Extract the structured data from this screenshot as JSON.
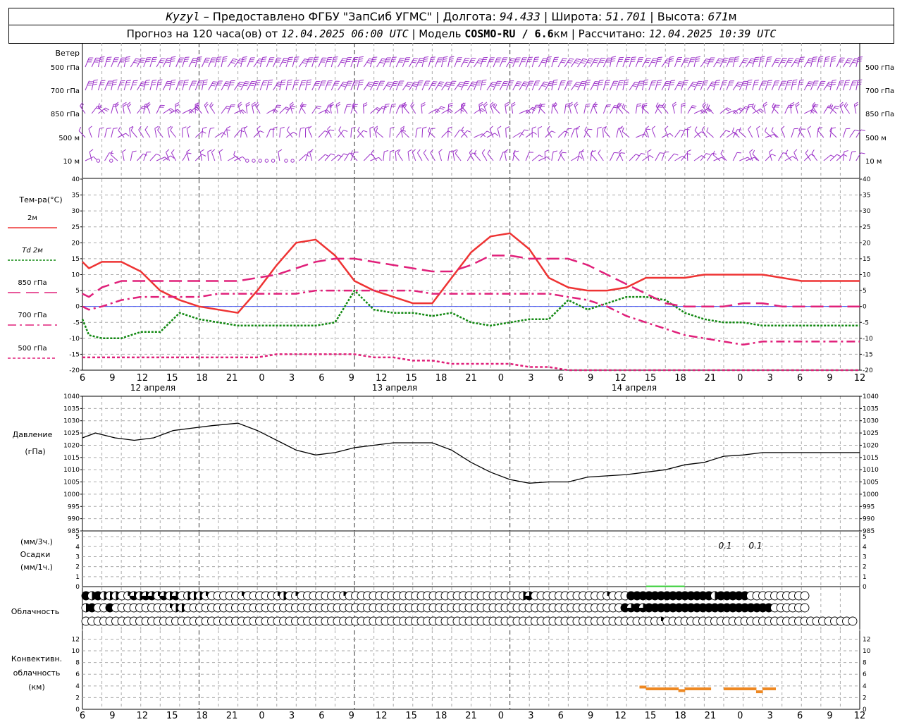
{
  "header": {
    "station": "Kyzyl",
    "provided": "Предоставлено ФГБУ \"ЗапСиб УГМС\"",
    "lon_label": "Долгота:",
    "lon": "94.433",
    "lat_label": "Широта:",
    "lat": "51.701",
    "alt_label": "Высота:",
    "alt": "671",
    "alt_unit": "м",
    "fc_label": "Прогноз на 120 часа(ов) от",
    "fc_time": "12.04.2025 06:00 UTC",
    "model_label": "Модель",
    "model": "COSMO-RU / 6.6",
    "model_unit": "км",
    "calc_label": "Рассчитано:",
    "calc_time": "12.04.2025 10:39 UTC"
  },
  "time_axis": {
    "ticks": [
      "6",
      "9",
      "12",
      "15",
      "18",
      "21",
      "0",
      "3",
      "6",
      "9",
      "12",
      "15",
      "18",
      "21",
      "0",
      "3",
      "6",
      "9",
      "12",
      "15",
      "18",
      "21",
      "0",
      "3",
      "6",
      "9",
      "12"
    ],
    "days": [
      "12 апреля",
      "13 апреля",
      "14 апреля"
    ]
  },
  "wind": {
    "title": "Ветер",
    "levels": [
      "500 гПа",
      "700 гПа",
      "850 гПа",
      "500 м",
      "10 м"
    ],
    "color": "#9b30c8"
  },
  "temperature": {
    "title": "Тем-ра(°C)",
    "legend": [
      {
        "label": "2м",
        "color": "#ee3333"
      },
      {
        "label": "Td  2м",
        "color": "#118811"
      },
      {
        "label": "850 гПа",
        "color": "#e0207a"
      },
      {
        "label": "700 гПа",
        "color": "#e0207a"
      },
      {
        "label": "500 гПа",
        "color": "#e0207a"
      }
    ],
    "ticks": [
      "40",
      "35",
      "30",
      "25",
      "20",
      "15",
      "10",
      "5",
      "0",
      "-5",
      "-10",
      "-15",
      "-20"
    ]
  },
  "pressure": {
    "title1": "Давление",
    "title2": "(гПа)",
    "ticks": [
      "1040",
      "1035",
      "1030",
      "1025",
      "1020",
      "1015",
      "1010",
      "1005",
      "1000",
      "995",
      "990",
      "985"
    ]
  },
  "precip": {
    "title1": "(мм/3ч.)",
    "title2": "Осадки",
    "title3": "(мм/1ч.)",
    "ticks": [
      "5",
      "4",
      "3",
      "2",
      "1",
      "0"
    ],
    "labels": [
      "0.1",
      "0.1"
    ]
  },
  "cloud": {
    "title": "Облачность"
  },
  "conv": {
    "title1": "Конвективн.",
    "title2": "облачность",
    "title3": "(км)",
    "ticks": [
      "12",
      "10",
      "8",
      "6",
      "4",
      "2",
      "0"
    ]
  },
  "chart_data": [
    {
      "type": "line",
      "title": "Тем-ра(°C)",
      "x_hours": [
        0,
        1,
        3,
        6,
        9,
        12,
        15,
        18,
        21,
        24,
        27,
        30,
        33,
        36,
        39,
        42,
        45,
        48,
        51,
        54,
        57,
        60,
        63,
        66,
        69,
        72,
        75,
        78,
        81,
        84,
        87,
        90,
        93,
        96,
        99,
        102,
        105,
        108,
        111,
        114,
        117,
        120
      ],
      "ylim": [
        -20,
        40
      ],
      "series": [
        {
          "name": "2м",
          "values": [
            14,
            12,
            14,
            14,
            11,
            5,
            2,
            0,
            -1,
            -2,
            5,
            13,
            20,
            21,
            16,
            8,
            5,
            3,
            1,
            1,
            9,
            17,
            22,
            23,
            18,
            9,
            6,
            5,
            5,
            6,
            9,
            9,
            9,
            10,
            10,
            10,
            10,
            9,
            8,
            8,
            8,
            8
          ]
        },
        {
          "name": "Td  2м",
          "values": [
            -4,
            -9,
            -10,
            -10,
            -8,
            -8,
            -2,
            -4,
            -5,
            -6,
            -6,
            -6,
            -6,
            -6,
            -5,
            5,
            -1,
            -2,
            -2,
            -3,
            -2,
            -5,
            -6,
            -5,
            -4,
            -4,
            2,
            -1,
            1,
            3,
            3,
            2,
            -2,
            -4,
            -5,
            -5,
            -6,
            -6,
            -6,
            -6,
            -6,
            -6
          ]
        },
        {
          "name": "850 гПа",
          "values": [
            4,
            3,
            6,
            8,
            8,
            8,
            8,
            8,
            8,
            8,
            9,
            10,
            12,
            14,
            15,
            15,
            14,
            13,
            12,
            11,
            11,
            13,
            16,
            16,
            15,
            15,
            15,
            13,
            10,
            7,
            4,
            1,
            0,
            0,
            0,
            1,
            1,
            0,
            0,
            0,
            0,
            0
          ]
        },
        {
          "name": "700 гПа",
          "values": [
            0,
            -1,
            0,
            2,
            3,
            3,
            3,
            3,
            4,
            4,
            4,
            4,
            4,
            5,
            5,
            5,
            5,
            5,
            5,
            4,
            4,
            4,
            4,
            4,
            4,
            4,
            3,
            2,
            0,
            -3,
            -5,
            -7,
            -9,
            -10,
            -11,
            -12,
            -11,
            -11,
            -11,
            -11,
            -11,
            -11
          ]
        },
        {
          "name": "500 гПа",
          "values": [
            -16,
            -16,
            -16,
            -16,
            -16,
            -16,
            -16,
            -16,
            -16,
            -16,
            -16,
            -15,
            -15,
            -15,
            -15,
            -15,
            -16,
            -16,
            -17,
            -17,
            -18,
            -18,
            -18,
            -18,
            -19,
            -19,
            -20,
            -20,
            -20,
            -20,
            -20,
            -20,
            -20,
            -20,
            -20,
            -20,
            -20,
            -20,
            -20,
            -20,
            -20,
            -20
          ]
        }
      ]
    },
    {
      "type": "line",
      "title": "Давление",
      "x_hours": [
        0,
        2,
        5,
        8,
        11,
        14,
        17,
        20,
        24,
        27,
        30,
        33,
        36,
        39,
        42,
        45,
        48,
        51,
        54,
        57,
        60,
        63,
        66,
        69,
        72,
        75,
        78,
        81,
        84,
        87,
        90,
        93,
        96,
        99,
        102,
        105,
        108,
        111,
        114,
        117,
        120
      ],
      "ylim": [
        985,
        1040
      ],
      "series": [
        {
          "name": "Давление",
          "values": [
            1023,
            1025,
            1023,
            1022,
            1023,
            1026,
            1027,
            1028,
            1029,
            1026,
            1022,
            1018,
            1016,
            1017,
            1019,
            1020,
            1021,
            1021,
            1021,
            1018,
            1013,
            1009,
            1006,
            1004.5,
            1005,
            1005,
            1007,
            1007.5,
            1008,
            1009,
            1010,
            1012,
            1013,
            1015.5,
            1016,
            1017,
            1017,
            1017,
            1017,
            1017,
            1017
          ]
        }
      ]
    },
    {
      "type": "bar",
      "title": "Осадки",
      "x_hours": [
        87,
        90
      ],
      "ylim": [
        0,
        5
      ],
      "series": [
        {
          "values": [
            0.1,
            0.1
          ]
        }
      ]
    },
    {
      "type": "table",
      "title": "Облачность",
      "note": "cloud cover fraction per hour in three layers",
      "rows": [
        {
          "values": [
            1,
            0.5,
            1,
            0.5,
            0.5,
            0.5,
            0,
            0.25,
            0.75,
            0.5,
            0.75,
            0.75,
            0.25,
            0.75,
            0.5,
            0.75,
            0,
            0.5,
            0.5,
            0.5,
            0.25,
            0,
            0,
            0,
            0,
            0,
            0.25,
            0,
            0,
            0,
            0,
            0,
            0.25,
            0.5,
            0,
            0.25,
            0,
            0,
            0,
            0,
            0,
            0,
            0,
            0.25,
            0,
            0,
            0,
            0,
            0,
            0,
            0,
            0,
            0,
            0,
            0,
            0,
            0,
            0,
            0,
            0,
            0,
            0,
            0,
            0,
            0,
            0,
            0,
            0,
            0,
            0,
            0,
            0,
            0,
            0.5,
            0.75,
            0,
            0,
            0,
            0,
            0,
            0,
            0,
            0,
            0,
            0,
            0,
            0,
            0.25,
            0,
            0,
            0,
            1,
            1,
            1,
            1,
            1,
            1,
            1,
            1,
            1,
            1,
            1,
            1,
            1,
            1,
            0.5,
            1,
            1,
            1,
            1,
            1,
            0,
            0,
            0,
            0,
            0,
            0,
            0,
            0,
            0,
            0
          ]
        },
        {
          "values": [
            0.5,
            1,
            0,
            0,
            1,
            0,
            0,
            0,
            0,
            0,
            0,
            0,
            0,
            0,
            0.25,
            0.5,
            0.5,
            0,
            0,
            0,
            0,
            0,
            0,
            0,
            0,
            0,
            0,
            0,
            0,
            0,
            0,
            0,
            0,
            0,
            0,
            0,
            0,
            0,
            0,
            0,
            0,
            0,
            0,
            0,
            0,
            0,
            0,
            0,
            0,
            0,
            0,
            0,
            0,
            0,
            0,
            0,
            0,
            0,
            0,
            0,
            0,
            0,
            0,
            0,
            0,
            0,
            0,
            0,
            0,
            0,
            0,
            0,
            0,
            0,
            0,
            0,
            0,
            0,
            0,
            0,
            0,
            0,
            0,
            0,
            0,
            0,
            0,
            0,
            0,
            0,
            1,
            0.75,
            1,
            0.75,
            1,
            1,
            1,
            1,
            1,
            1,
            1,
            1,
            1,
            1,
            1,
            1,
            1,
            1,
            1,
            1,
            1,
            1,
            1,
            1,
            1,
            0,
            0,
            0,
            0,
            0,
            0
          ]
        },
        {
          "values": [
            0,
            0,
            0,
            0,
            0,
            0,
            0,
            0,
            0,
            0,
            0,
            0,
            0,
            0,
            0,
            0,
            0,
            0,
            0,
            0,
            0,
            0,
            0,
            0,
            0,
            0,
            0,
            0,
            0,
            0,
            0,
            0,
            0,
            0,
            0,
            0,
            0,
            0,
            0,
            0,
            0,
            0,
            0,
            0,
            0,
            0,
            0,
            0,
            0,
            0,
            0,
            0,
            0,
            0,
            0,
            0,
            0,
            0,
            0,
            0,
            0,
            0,
            0,
            0,
            0,
            0,
            0,
            0,
            0,
            0,
            0,
            0,
            0,
            0,
            0,
            0,
            0,
            0,
            0,
            0,
            0,
            0,
            0,
            0,
            0,
            0,
            0,
            0,
            0,
            0,
            0,
            0,
            0,
            0,
            0,
            0,
            0.25,
            0,
            0,
            0,
            0,
            0,
            0,
            0,
            0,
            0,
            0,
            0,
            0,
            0,
            0,
            0,
            0,
            0,
            0,
            0,
            0,
            0,
            0,
            0,
            0,
            0,
            0,
            0,
            0,
            0,
            0,
            0,
            0
          ]
        }
      ]
    },
    {
      "type": "bar",
      "title": "Конвективн. облачность",
      "segments": [
        {
          "x": [
            86,
            87
          ],
          "y": 3.8
        },
        {
          "x": [
            87,
            88
          ],
          "y": 3.5
        },
        {
          "x": [
            88,
            89
          ],
          "y": 3.5
        },
        {
          "x": [
            89,
            90
          ],
          "y": 3.5
        },
        {
          "x": [
            90,
            91
          ],
          "y": 3.5
        },
        {
          "x": [
            91,
            92
          ],
          "y": 3.5
        },
        {
          "x": [
            92,
            93
          ],
          "y": 3.2
        },
        {
          "x": [
            93,
            94
          ],
          "y": 3.5
        },
        {
          "x": [
            94,
            95
          ],
          "y": 3.5
        },
        {
          "x": [
            95,
            96
          ],
          "y": 3.5
        },
        {
          "x": [
            96,
            97
          ],
          "y": 3.5
        },
        {
          "x": [
            99,
            100
          ],
          "y": 3.5
        },
        {
          "x": [
            100,
            101
          ],
          "y": 3.5
        },
        {
          "x": [
            101,
            102
          ],
          "y": 3.5
        },
        {
          "x": [
            102,
            103
          ],
          "y": 3.5
        },
        {
          "x": [
            103,
            104
          ],
          "y": 3.5
        },
        {
          "x": [
            104,
            105
          ],
          "y": 3.0
        },
        {
          "x": [
            105,
            106
          ],
          "y": 3.5
        },
        {
          "x": [
            106,
            107
          ],
          "y": 3.5
        }
      ],
      "ylim": [
        0,
        13
      ]
    }
  ]
}
